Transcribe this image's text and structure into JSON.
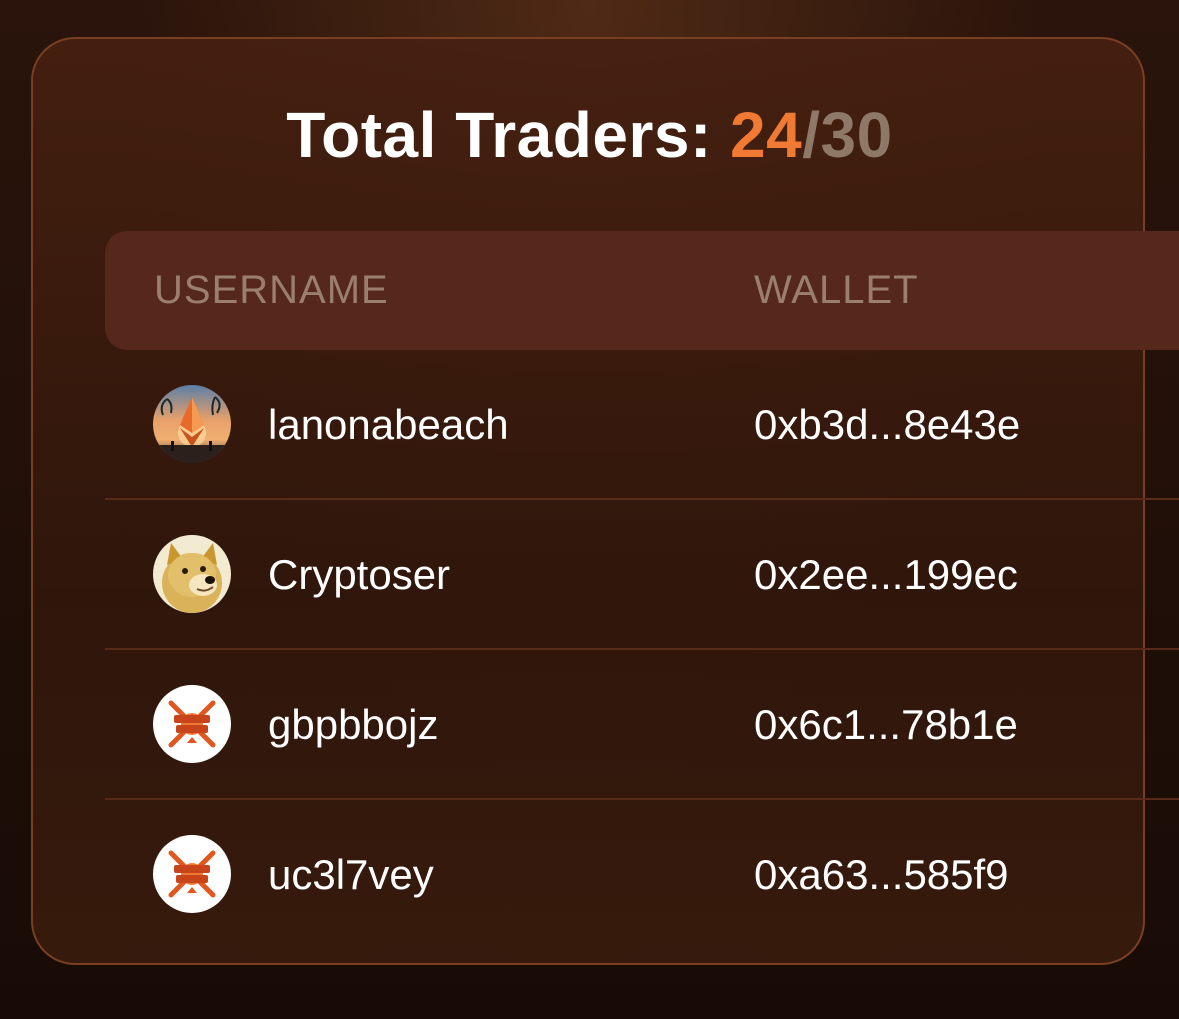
{
  "title": {
    "label": "Total Traders: ",
    "count": "24",
    "slash": "/",
    "max": "30"
  },
  "table": {
    "headers": {
      "username": "USERNAME",
      "wallet": "WALLET"
    },
    "rows": [
      {
        "username": "lanonabeach",
        "wallet": "0xb3d...8e43e",
        "avatar": "ethereum-beach-avatar"
      },
      {
        "username": "Cryptoser",
        "wallet": "0x2ee...199ec",
        "avatar": "doge-avatar"
      },
      {
        "username": "gbpbbojz",
        "wallet": "0x6c1...78b1e",
        "avatar": "on-chain-battles-avatar"
      },
      {
        "username": "uc3l7vey",
        "wallet": "0xa63...585f9",
        "avatar": "on-chain-battles-avatar"
      }
    ]
  },
  "colors": {
    "accent": "#f07a34",
    "muted": "#8e7868",
    "header_bg": "#56281b",
    "card_border": "#7a3f22"
  }
}
